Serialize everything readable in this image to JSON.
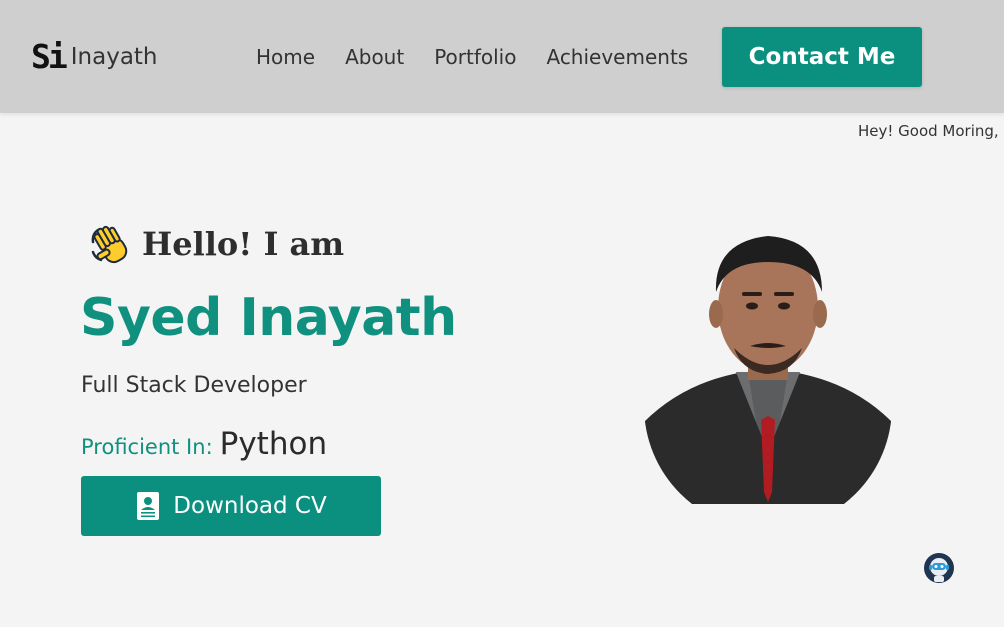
{
  "navbar": {
    "logo_mark": "Si",
    "logo_text": "Inayath",
    "links": [
      "Home",
      "About",
      "Portfolio",
      "Achievements"
    ],
    "contact_label": "Contact Me"
  },
  "greeting_marquee": "Hey! Good Moring,",
  "hero": {
    "hello": "Hello! I am",
    "wave_icon": "waving-hand-icon",
    "name": "Syed Inayath",
    "role": "Full Stack Developer",
    "proficient_label": "Proficient In:",
    "proficient_value": "Python",
    "download_label": "Download CV",
    "download_icon": "document-icon"
  },
  "chatbot_icon": "robot-chat-icon",
  "colors": {
    "accent": "#0b9080",
    "navbar_bg": "#cfcfcf",
    "page_bg": "#f4f4f4"
  }
}
